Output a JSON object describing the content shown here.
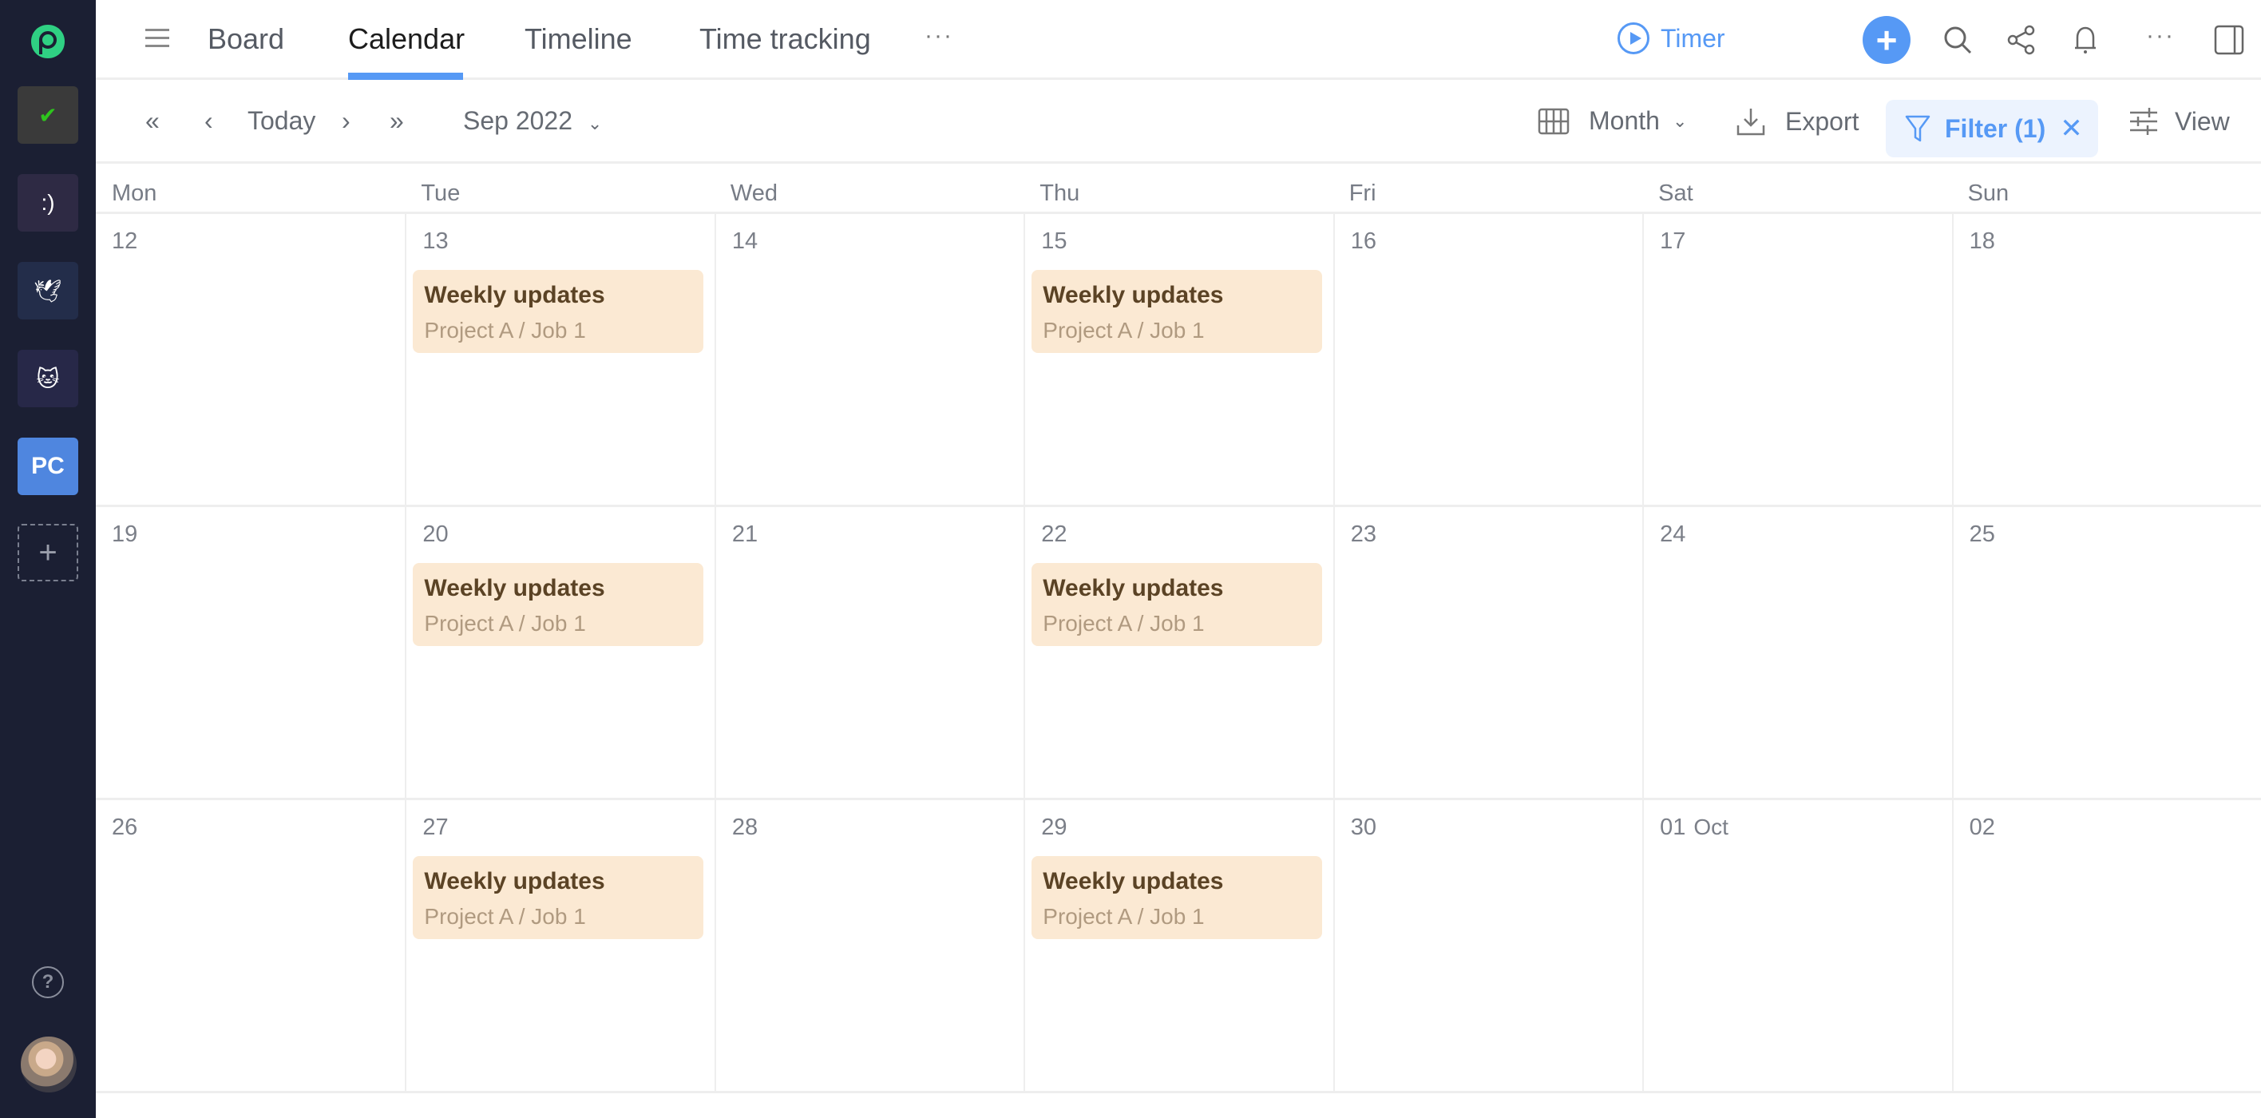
{
  "sidebar": {
    "logo": "app-logo",
    "workspaces": [
      {
        "name": "workspace-check",
        "glyph": "✔",
        "bg": "#3a3a3a",
        "color": "#2ec41d"
      },
      {
        "name": "workspace-smiley",
        "glyph": ":)",
        "bg": "#2e2a44",
        "color": "#ffffff"
      },
      {
        "name": "workspace-dove",
        "glyph": "🕊",
        "bg": "#232d4a",
        "color": "#ffffff"
      },
      {
        "name": "workspace-cat",
        "glyph": "🐱",
        "bg": "#272848",
        "color": "#ffffff"
      },
      {
        "name": "workspace-pc",
        "glyph": "PC",
        "bg": "#4f86df",
        "color": "#ffffff"
      }
    ],
    "add_workspace": "+",
    "help": "?"
  },
  "header": {
    "tabs": [
      {
        "label": "Board",
        "active": false
      },
      {
        "label": "Calendar",
        "active": true
      },
      {
        "label": "Timeline",
        "active": false
      },
      {
        "label": "Time tracking",
        "active": false
      }
    ],
    "more": "···",
    "timer_label": "Timer",
    "add": "+",
    "overflow": "···"
  },
  "toolbar": {
    "first": "«",
    "prev": "‹",
    "today": "Today",
    "next": "›",
    "last": "»",
    "current_month": "Sep 2022",
    "view_mode": "Month",
    "export": "Export",
    "filter": "Filter (1)",
    "view": "View"
  },
  "calendar": {
    "weekdays": [
      "Mon",
      "Tue",
      "Wed",
      "Thu",
      "Fri",
      "Sat",
      "Sun"
    ],
    "weeks": [
      {
        "days": [
          {
            "num": "12"
          },
          {
            "num": "13",
            "event": {
              "title": "Weekly updates",
              "sub": "Project A / Job 1"
            }
          },
          {
            "num": "14"
          },
          {
            "num": "15",
            "event": {
              "title": "Weekly updates",
              "sub": "Project A / Job 1"
            }
          },
          {
            "num": "16"
          },
          {
            "num": "17"
          },
          {
            "num": "18"
          }
        ]
      },
      {
        "days": [
          {
            "num": "19"
          },
          {
            "num": "20",
            "event": {
              "title": "Weekly updates",
              "sub": "Project A / Job 1"
            }
          },
          {
            "num": "21"
          },
          {
            "num": "22",
            "event": {
              "title": "Weekly updates",
              "sub": "Project A / Job 1"
            }
          },
          {
            "num": "23"
          },
          {
            "num": "24"
          },
          {
            "num": "25"
          }
        ]
      },
      {
        "days": [
          {
            "num": "26"
          },
          {
            "num": "27",
            "event": {
              "title": "Weekly updates",
              "sub": "Project A / Job 1"
            }
          },
          {
            "num": "28"
          },
          {
            "num": "29",
            "event": {
              "title": "Weekly updates",
              "sub": "Project A / Job 1"
            }
          },
          {
            "num": "30"
          },
          {
            "num": "01",
            "month": "Oct"
          },
          {
            "num": "02"
          }
        ]
      }
    ]
  }
}
